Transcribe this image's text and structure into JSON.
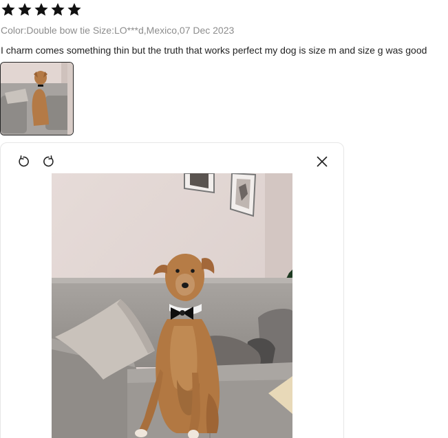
{
  "review": {
    "rating": 5,
    "rating_max": 5,
    "star_color": "#111111",
    "meta_line": "Color:Double bow tie Size:LO***d,Mexico,07 Dec 2023",
    "text": "I charm comes something thin but the truth that works perfect my dog is size m and size g was good"
  },
  "icons": {
    "rotate_left": "rotate-left-icon",
    "rotate_right": "rotate-right-icon",
    "close": "close-icon"
  }
}
